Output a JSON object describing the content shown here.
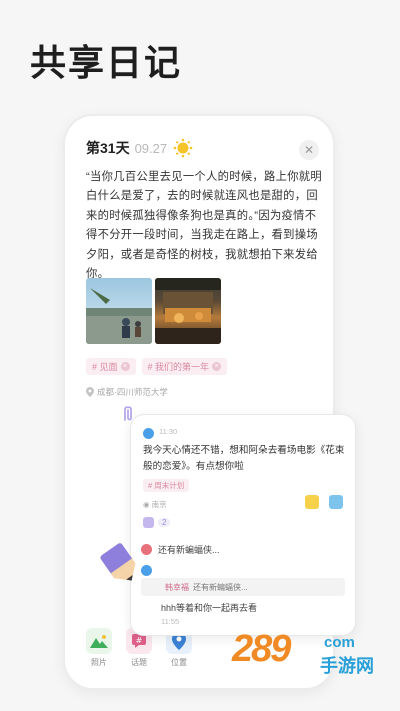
{
  "headline": "共享日记",
  "diary": {
    "day": "第31天",
    "date": "09.27",
    "weather_icon": "sun-icon",
    "body": "“当你几百公里去见一个人的时候，路上你就明白什么是爱了，去的时候就连风也是甜的，回来的时候孤独得像条狗也是真的。”因为疫情不得不分开一段时间，当我走在路上，看到操场夕阳，或者是奇怪的树枝，我就想拍下来发给你。",
    "tags": [
      "# 见面",
      "# 我们的第一年"
    ],
    "location": "成都·四川师范大学"
  },
  "tabbar": {
    "items": [
      {
        "label": "照片",
        "icon": "mountain-photo-icon"
      },
      {
        "label": "话题",
        "icon": "topic-icon"
      },
      {
        "label": "位置",
        "icon": "location-pin-icon"
      }
    ]
  },
  "comment": {
    "time": "11:30",
    "text": "我今天心情还不错，想和阿朵去看场电影《花束般的恋爱》。有点想你啦",
    "tag": "# 周末计划",
    "location": "南京",
    "like_count": "2",
    "reply1": "还有新蝙蝠侠...",
    "quote_name": "韩幸福",
    "quote_text": "还有新蝙蝠侠...",
    "reply2": "hhh等着和你一起再去看",
    "reply2_time": "11:55"
  },
  "watermark": {
    "logo": "289",
    "com": "com",
    "site": "手游网"
  },
  "colors": {
    "tag_bg": "#fbeef2",
    "tag_text": "#d98aa0",
    "accent_purple": "#8f7fdc"
  }
}
